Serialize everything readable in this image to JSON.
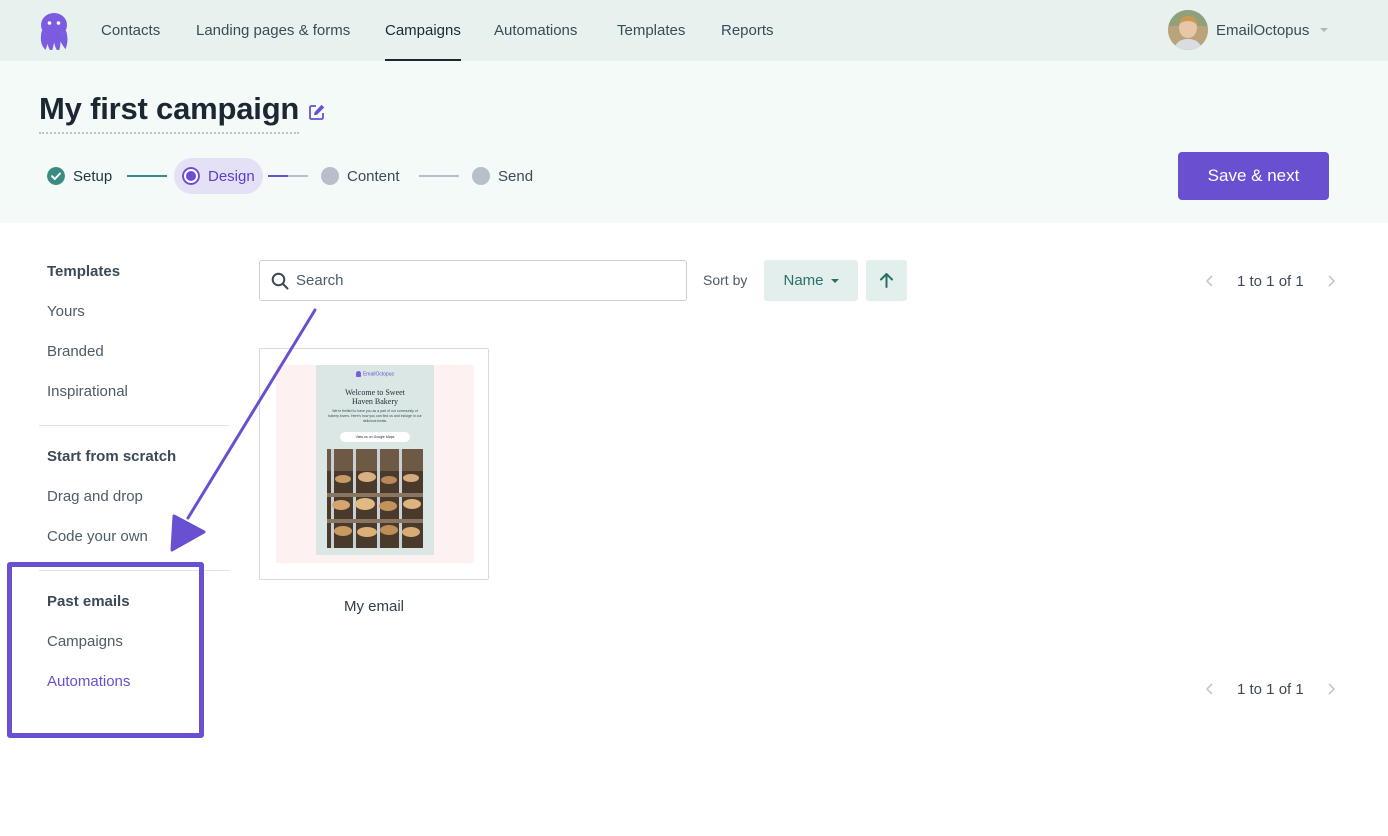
{
  "nav": {
    "links": [
      "Contacts",
      "Landing pages & forms",
      "Campaigns",
      "Automations",
      "Templates",
      "Reports"
    ],
    "active": "Campaigns",
    "account_name": "EmailOctopus"
  },
  "page": {
    "title": "My first campaign"
  },
  "steps": [
    {
      "label": "Setup",
      "state": "complete"
    },
    {
      "label": "Design",
      "state": "current"
    },
    {
      "label": "Content",
      "state": "upcoming"
    },
    {
      "label": "Send",
      "state": "upcoming"
    }
  ],
  "actions": {
    "save_next": "Save & next"
  },
  "sidebar": {
    "templates_heading": "Templates",
    "templates_items": [
      "Yours",
      "Branded",
      "Inspirational"
    ],
    "scratch_heading": "Start from scratch",
    "scratch_items": [
      "Drag and drop",
      "Code your own"
    ],
    "past_heading": "Past emails",
    "past_items": [
      "Campaigns",
      "Automations"
    ],
    "active_item": "Automations"
  },
  "toolbar": {
    "search_placeholder": "Search",
    "sort_label": "Sort by",
    "sort_value": "Name",
    "pagination": "1 to 1 of 1"
  },
  "templates": [
    {
      "name": "My email",
      "preview": {
        "brand": "EmailOctopus",
        "heading": "Welcome to Sweet Haven Bakery",
        "body": "We're thrilled to have you as a part of our community of bakery lovers. Here's how you can find us and indulge in our delicious treats.",
        "button": "View us on Google Maps"
      }
    }
  ],
  "colors": {
    "accent": "#6a4fd1",
    "nav_bg": "#e7f2ef",
    "header_bg": "#f4faf8",
    "teal": "#2a6f66",
    "step_complete": "#3c8a84"
  }
}
